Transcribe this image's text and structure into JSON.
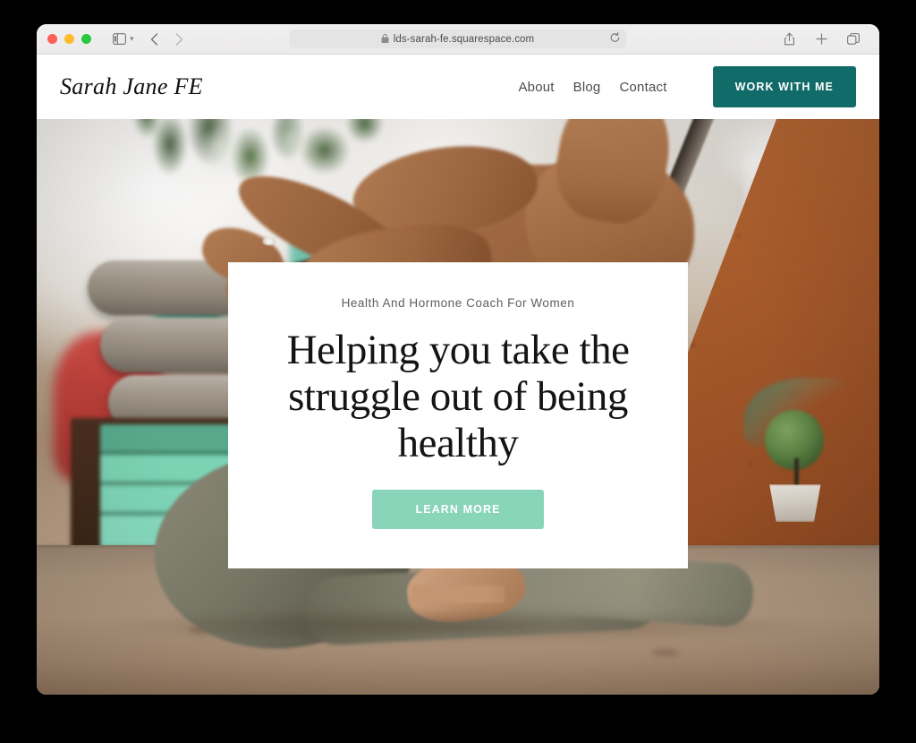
{
  "browser": {
    "traffic_lights": [
      "close",
      "minimize",
      "zoom"
    ],
    "sidebar_icon": "sidebar-icon",
    "sidebar_chevron": "chevron-down-icon",
    "back_icon": "chevron-left-icon",
    "forward_icon": "chevron-right-icon",
    "lock_icon": "lock-icon",
    "url": "lds-sarah-fe.squarespace.com",
    "reload_icon": "reload-icon",
    "share_icon": "share-icon",
    "new_tab_icon": "plus-icon",
    "tabs_icon": "tab-overview-icon"
  },
  "site": {
    "logo": "Sarah Jane FE",
    "nav": [
      {
        "label": "About"
      },
      {
        "label": "Blog"
      },
      {
        "label": "Contact"
      }
    ],
    "cta": {
      "label": "WORK WITH ME",
      "color": "#116b68"
    }
  },
  "hero": {
    "eyebrow": "Health And Hormone Coach For Women",
    "heading": "Helping you take the struggle out of being healthy",
    "button": {
      "label": "LEARN MORE",
      "color": "#89d5b9"
    },
    "photo_alt": "Woman in a yoga backbend pose on a wooden studio floor with grey bolsters, mint yoga blocks, a wooden A-frame wall and a small topiary plant"
  },
  "colors": {
    "page_background": "#000000",
    "card_background": "#ffffff",
    "accent_dark_teal": "#116b68",
    "accent_mint": "#89d5b9",
    "nav_text": "#4b4b4b",
    "heading_text": "#141414"
  }
}
